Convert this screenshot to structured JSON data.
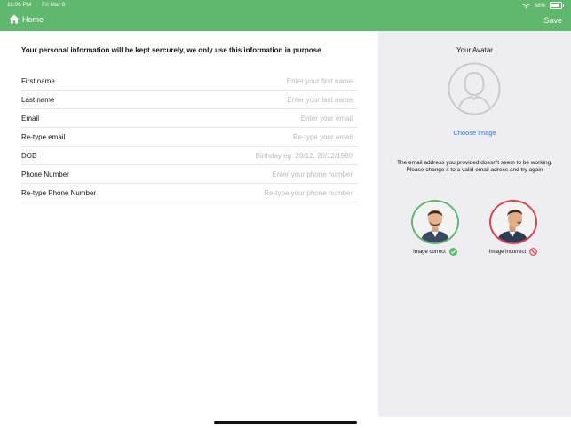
{
  "status_bar": {
    "time": "11:06 PM",
    "date": "Fri Mar 8",
    "battery": "88%"
  },
  "nav": {
    "home_label": "Home",
    "save_label": "Save"
  },
  "notice": "Your personal information will be kept sercurely, we only use this information in purpose",
  "form": {
    "fields": [
      {
        "label": "First name",
        "placeholder": "Enter your first name"
      },
      {
        "label": "Last name",
        "placeholder": "Enter your last name"
      },
      {
        "label": "Email",
        "placeholder": "Enter your email"
      },
      {
        "label": "Re-type email",
        "placeholder": "Re-type your email"
      },
      {
        "label": "DOB",
        "placeholder": "Birthday eg: 20/12, 20/12/1980"
      },
      {
        "label": "Phone Number",
        "placeholder": "Enter your phone number"
      },
      {
        "label": "Re-type Phone Number",
        "placeholder": "Re-type your phone number"
      }
    ]
  },
  "avatar_panel": {
    "title": "Your Avatar",
    "choose_label": "Choose image",
    "warning_line1": "The email address you provided doesn't seem to be working.",
    "warning_line2": "Please change it to a valid email adress and try again",
    "examples": [
      {
        "caption": "Image correct",
        "status": "correct"
      },
      {
        "caption": "Image incorrect",
        "status": "incorrect"
      }
    ]
  },
  "colors": {
    "brand_green": "#5fb86d",
    "link_blue": "#2a7ad6",
    "error_red": "#e0404a",
    "panel_gray": "#eeeef2"
  }
}
